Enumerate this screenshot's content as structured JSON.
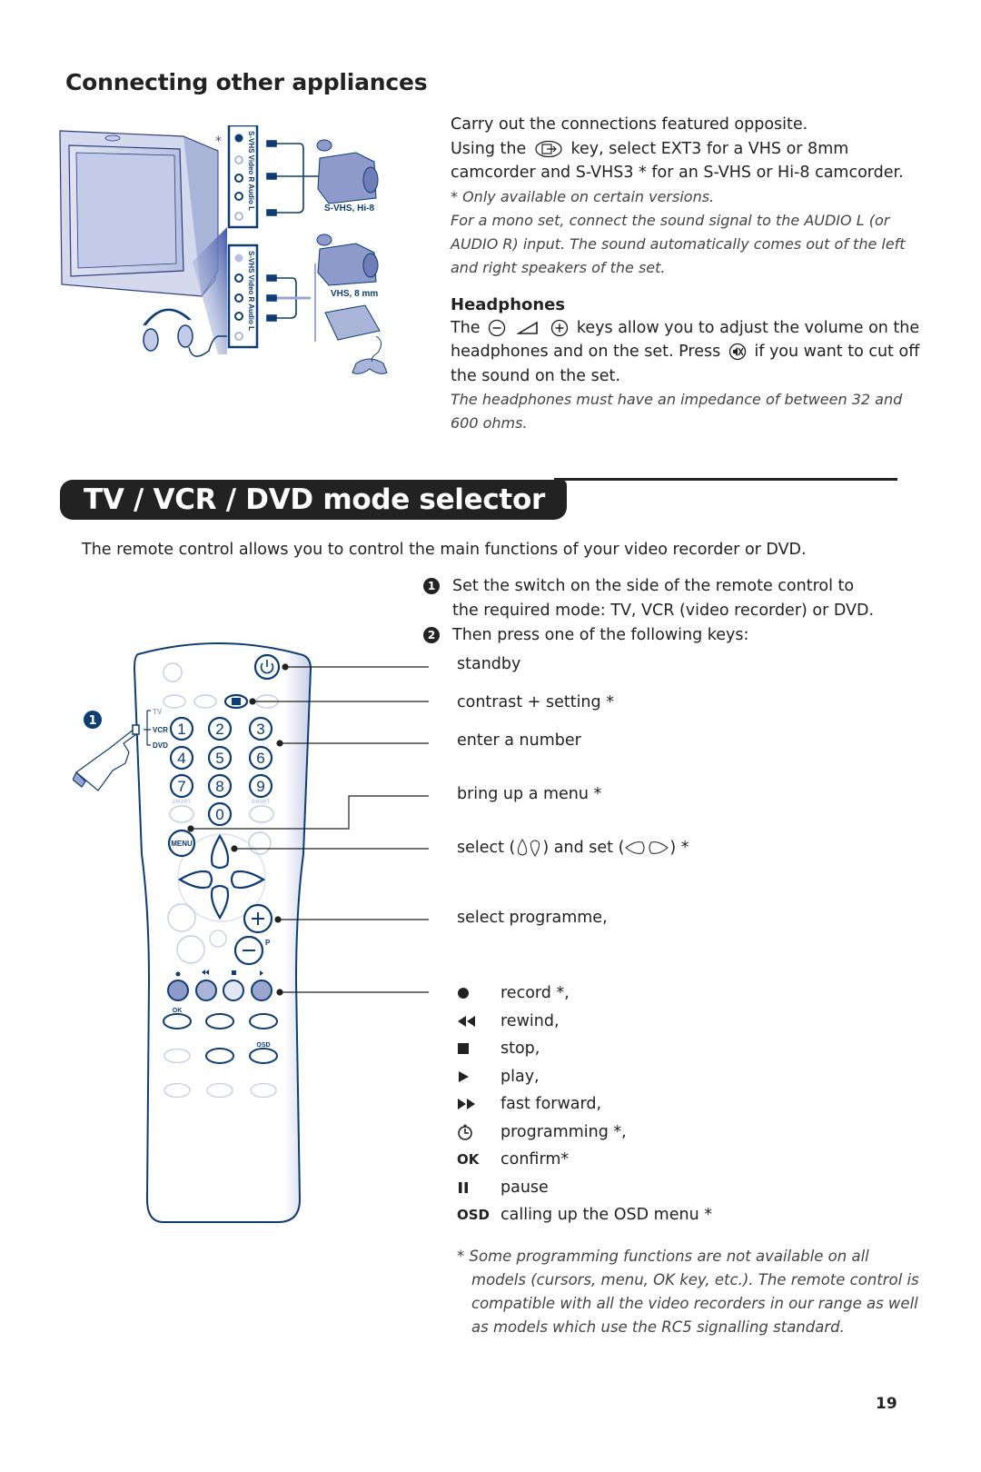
{
  "connecting": {
    "title": "Connecting other appliances",
    "p1": "Carry out the connections featured opposite.",
    "p2_a": "Using the",
    "p2_b": "key, select EXT3 for a VHS or 8mm camcorder and S-VHS3 * for an S-VHS or Hi-8 camcorder.",
    "note1": "* Only available on certain versions.",
    "note2": "For a mono set, connect the sound signal to the AUDIO L (or AUDIO R) input. The sound automatically comes out of the left and right speakers of the set.",
    "diagram": {
      "asterisk": "*",
      "panel_top": [
        "S-VHS",
        "Video",
        "R Audio L"
      ],
      "panel_bottom": [
        "S-VHS",
        "Video",
        "R Audio L"
      ],
      "label_top_device": "S-VHS, Hi-8",
      "label_bottom_device": "VHS, 8 mm"
    }
  },
  "headphones": {
    "title": "Headphones",
    "p_a": "The",
    "p_b": "keys allow you to adjust the volume on the headphones and on the set. Press",
    "p_c": "if you want to cut off the sound on the set.",
    "note": "The headphones must have an impedance of between 32 and 600 ohms."
  },
  "mode_selector": {
    "title": "TV / VCR / DVD mode selector",
    "intro": "The remote control allows you to control the main functions of your video recorder or DVD.",
    "steps": [
      {
        "num": "1",
        "text": "Set the switch on the side of the remote control to the required mode: TV, VCR (video recorder) or DVD."
      },
      {
        "num": "2",
        "text": "Then press one of the following keys:"
      }
    ],
    "remote": {
      "step_marker": "1",
      "switch_labels": [
        "TV",
        "VCR",
        "DVD"
      ],
      "digits": [
        "1",
        "2",
        "3",
        "4",
        "5",
        "6",
        "7",
        "8",
        "9",
        "0"
      ],
      "smart_label": "SMART",
      "menu_label": "MENU",
      "p_label": "P",
      "ok_label": "OK",
      "osd_label": "OSD"
    },
    "callouts": {
      "standby": "standby",
      "contrast": "contrast + setting *",
      "number": "enter a number",
      "menu": "bring up a menu *",
      "select_a": "select (",
      "select_b": ") and set (",
      "select_c": ") *",
      "programme": "select programme,"
    },
    "legend": [
      {
        "symbol": "record-icon",
        "label": "record *,"
      },
      {
        "symbol": "rewind-icon",
        "label": "rewind,"
      },
      {
        "symbol": "stop-icon",
        "label": "stop,"
      },
      {
        "symbol": "play-icon",
        "label": "play,"
      },
      {
        "symbol": "fast-forward-icon",
        "label": "fast forward,"
      },
      {
        "symbol": "timer-icon",
        "label": "programming *,"
      },
      {
        "symbol": "OK",
        "label": "confirm*"
      },
      {
        "symbol": "pause-icon",
        "label": "pause"
      },
      {
        "symbol": "OSD",
        "label": "calling up the OSD menu *"
      }
    ],
    "footnote": "* Some programming functions are not available on all models (cursors, menu, OK key, etc.). The remote control is compatible with all the video recorders in our range as well as models which use the RC5 signalling standard."
  },
  "page_number": "19",
  "colors": {
    "accent_blue": "#0d3d73",
    "light_blue": "#c5cde8",
    "text": "#222222"
  }
}
